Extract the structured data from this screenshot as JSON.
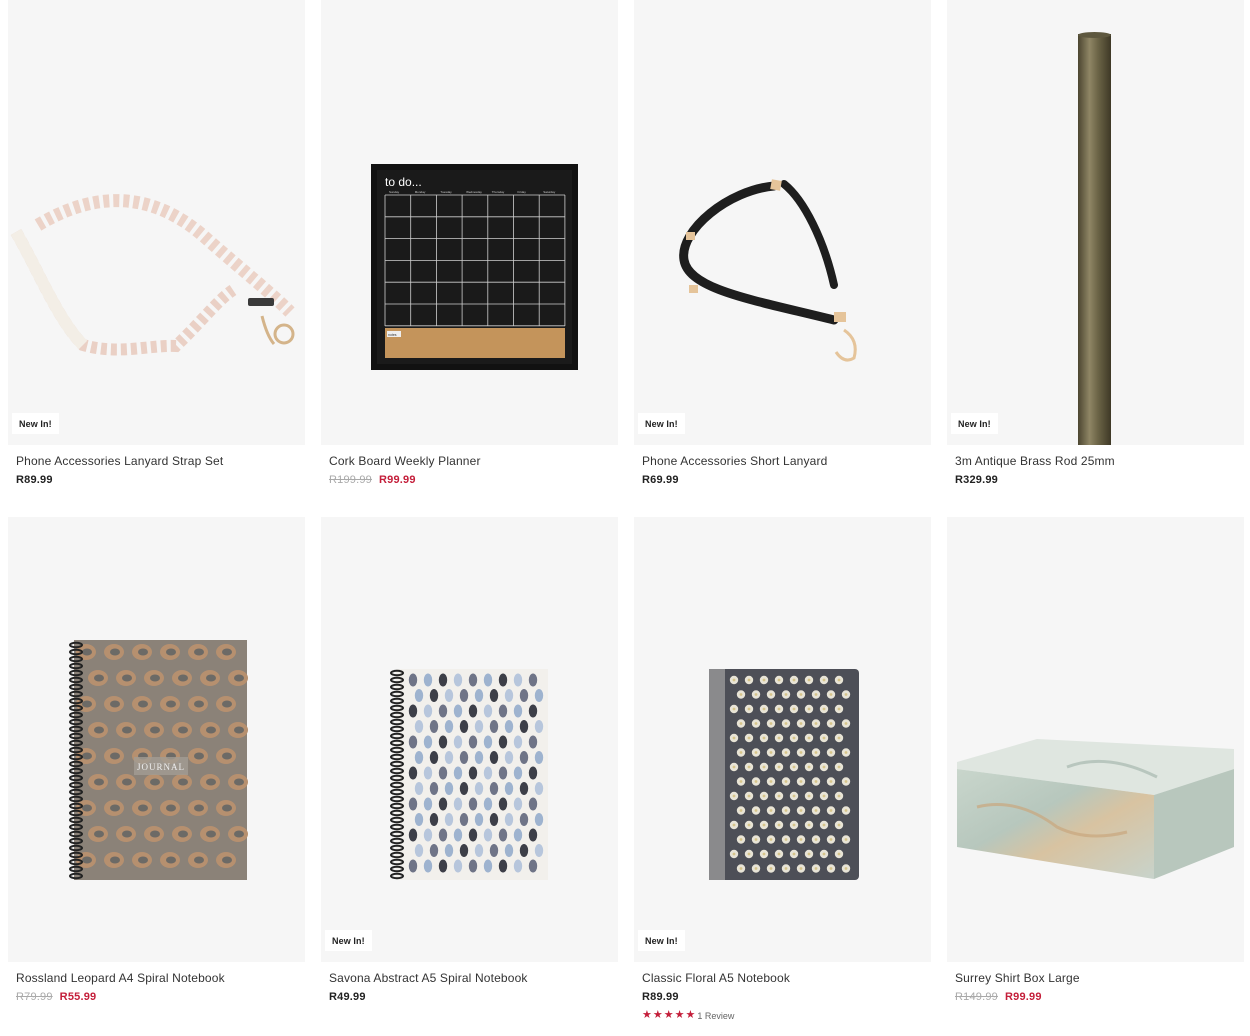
{
  "products": [
    {
      "name": "Phone Accessories Lanyard Strap Set",
      "badge": "New In!",
      "price": "R89.99",
      "was": "",
      "image": "lanyard-strap-image"
    },
    {
      "name": "Cork Board Weekly Planner",
      "badge": "",
      "price": "R99.99",
      "was": "R199.99",
      "image": "cork-board-planner-image",
      "planner": {
        "title": "to do...",
        "days": [
          "Sunday",
          "Monday",
          "Tuesday",
          "Wednesday",
          "Thursday",
          "Friday",
          "Saturday"
        ],
        "notes": "notes"
      }
    },
    {
      "name": "Phone Accessories Short Lanyard",
      "badge": "New In!",
      "price": "R69.99",
      "was": "",
      "image": "short-lanyard-image"
    },
    {
      "name": "3m Antique Brass Rod 25mm",
      "badge": "New In!",
      "price": "R329.99",
      "was": "",
      "image": "brass-rod-image"
    },
    {
      "name": "Rossland Leopard A4 Spiral Notebook",
      "badge": "",
      "price": "R55.99",
      "was": "R79.99",
      "image": "leopard-notebook-image",
      "cover_label": "JOURNAL"
    },
    {
      "name": "Savona Abstract A5 Spiral Notebook",
      "badge": "New In!",
      "price": "R49.99",
      "was": "",
      "image": "abstract-notebook-image"
    },
    {
      "name": "Classic Floral A5 Notebook",
      "badge": "New In!",
      "price": "R89.99",
      "was": "",
      "image": "floral-notebook-image",
      "rating": 5,
      "reviews": "1 Review"
    },
    {
      "name": "Surrey Shirt Box Large",
      "badge": "",
      "price": "R99.99",
      "was": "R149.99",
      "image": "shirt-box-image"
    }
  ],
  "colors": {
    "sale": "#c41e3a",
    "strike": "#a9a9a9",
    "tile_bg": "#f6f6f6",
    "star": "#c41e3a"
  }
}
